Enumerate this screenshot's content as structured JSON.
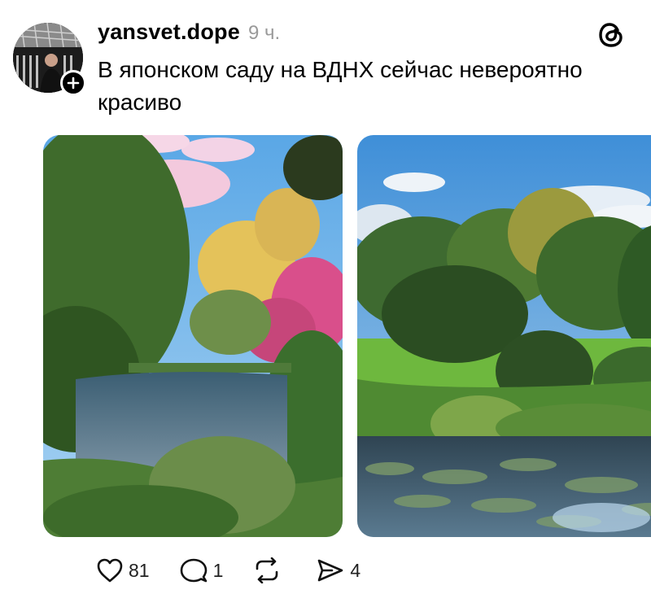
{
  "post": {
    "username": "yansvet.dope",
    "time": "9 ч.",
    "text": "В японском саду на ВДНХ сейчас невероятно красиво"
  },
  "icons": {
    "avatar": "profile-avatar",
    "follow": "plus-icon",
    "logo": "threads-logo-icon",
    "like": "heart-icon",
    "reply": "comment-bubble-icon",
    "repost": "repost-icon",
    "share": "send-icon"
  },
  "media": [
    {
      "description_icon": "photo-japanese-garden-pond-1"
    },
    {
      "description_icon": "photo-japanese-garden-pond-2"
    }
  ],
  "actions": {
    "likes": "81",
    "replies": "1",
    "reposts": "",
    "shares": "4"
  }
}
